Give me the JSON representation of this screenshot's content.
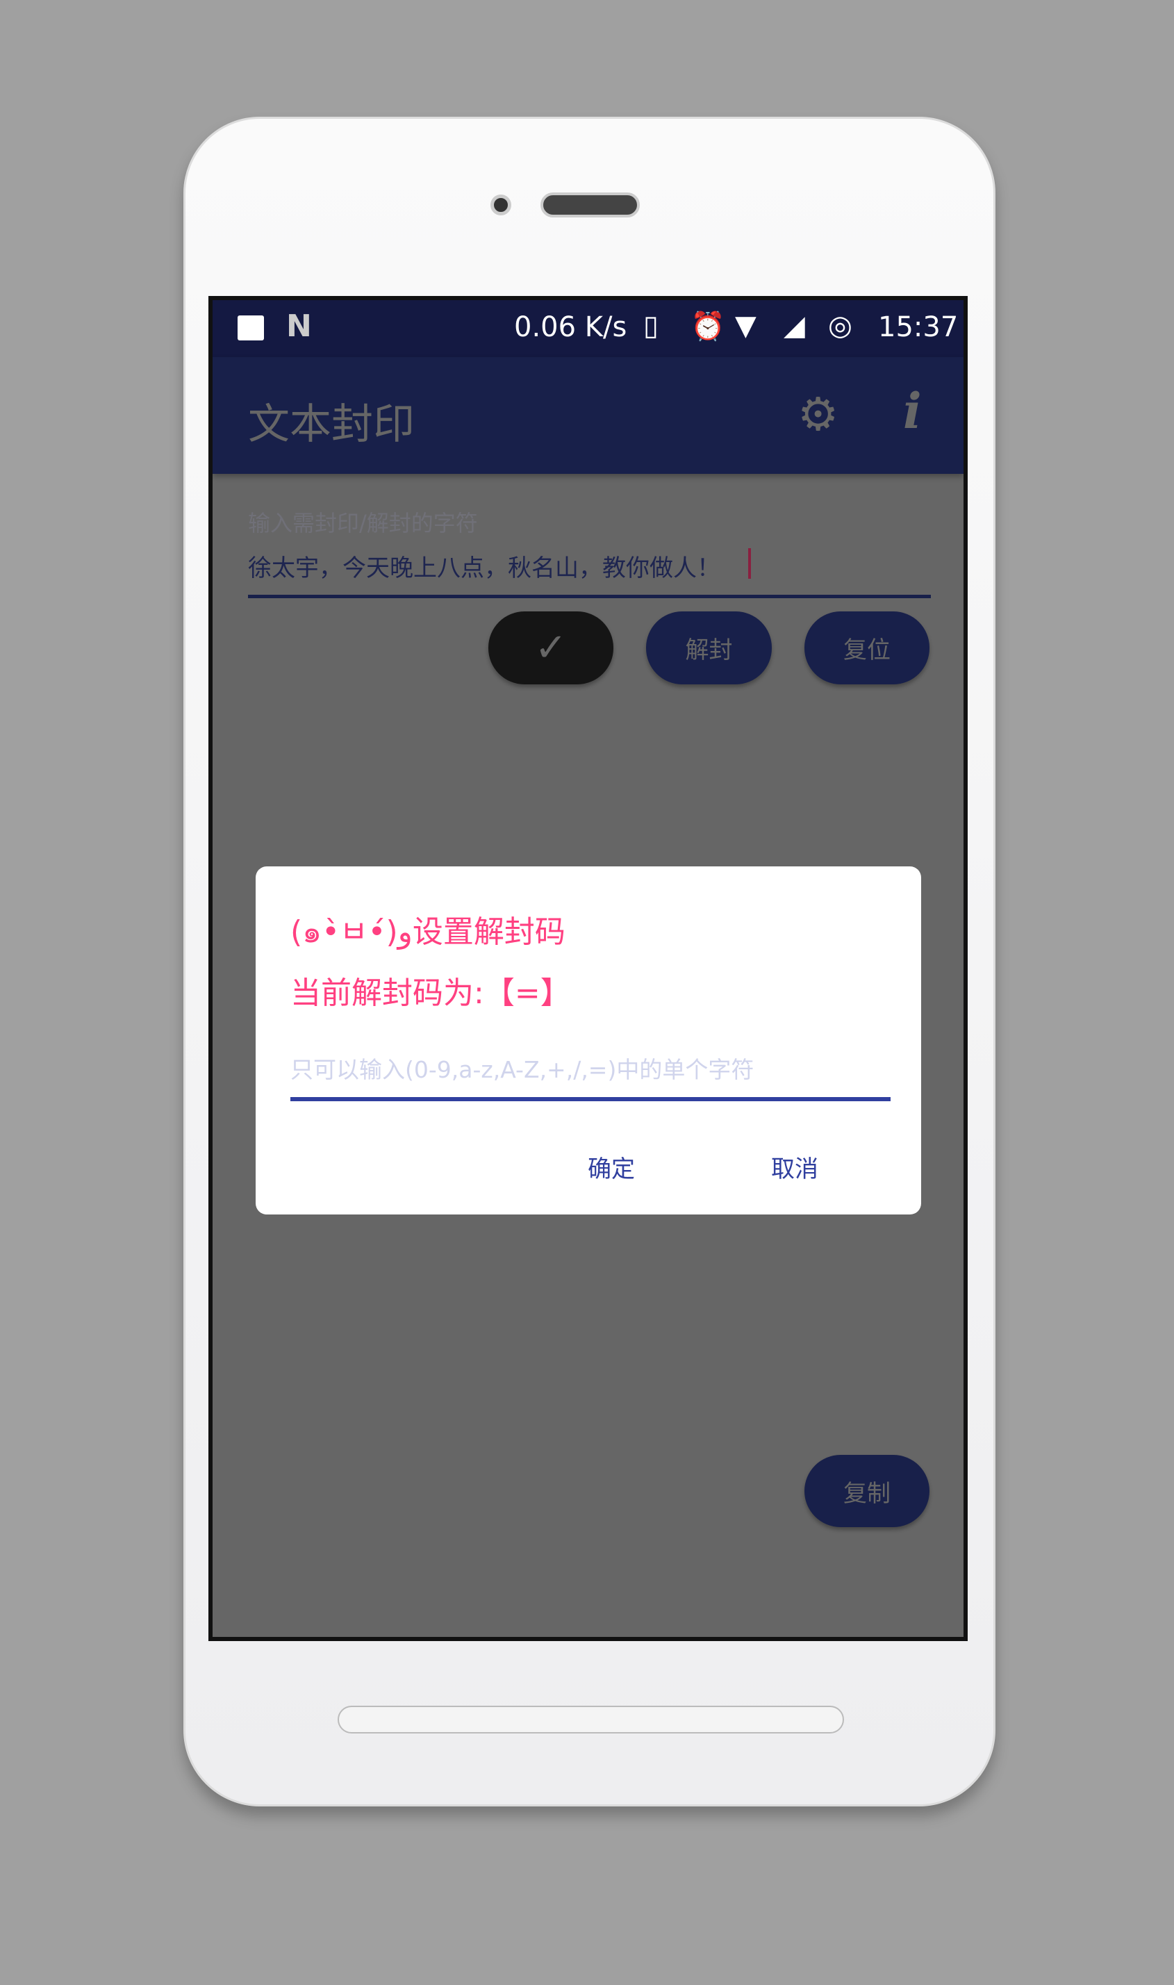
{
  "status_bar": {
    "net_speed": "0.06 K/s",
    "time": "15:37",
    "icons": [
      "image-icon",
      "n-icon",
      "vibrate-icon",
      "alarm-icon",
      "wifi-icon",
      "signal-icon",
      "sync-icon"
    ]
  },
  "app_bar": {
    "title": "文本封印",
    "icons": [
      "gear-icon",
      "info-icon"
    ]
  },
  "input": {
    "hint": "输入需封印/解封的字符",
    "value": "徐太宇，今天晚上八点，秋名山，教你做人！"
  },
  "buttons": {
    "seal_icon": "check-icon",
    "unseal": "解封",
    "reset": "复位",
    "copy": "复制"
  },
  "dialog": {
    "title": "(๑•̀ㅂ•́)و设置解封码",
    "current": "当前解封码为:【=】",
    "placeholder": "只可以输入(0-9,a-z,A-Z,+,/,=)中的单个字符",
    "value": "",
    "ok": "确定",
    "cancel": "取消"
  },
  "colors": {
    "accent": "#ff4081",
    "primary": "#18204a",
    "dialog_button": "#303f9f"
  }
}
